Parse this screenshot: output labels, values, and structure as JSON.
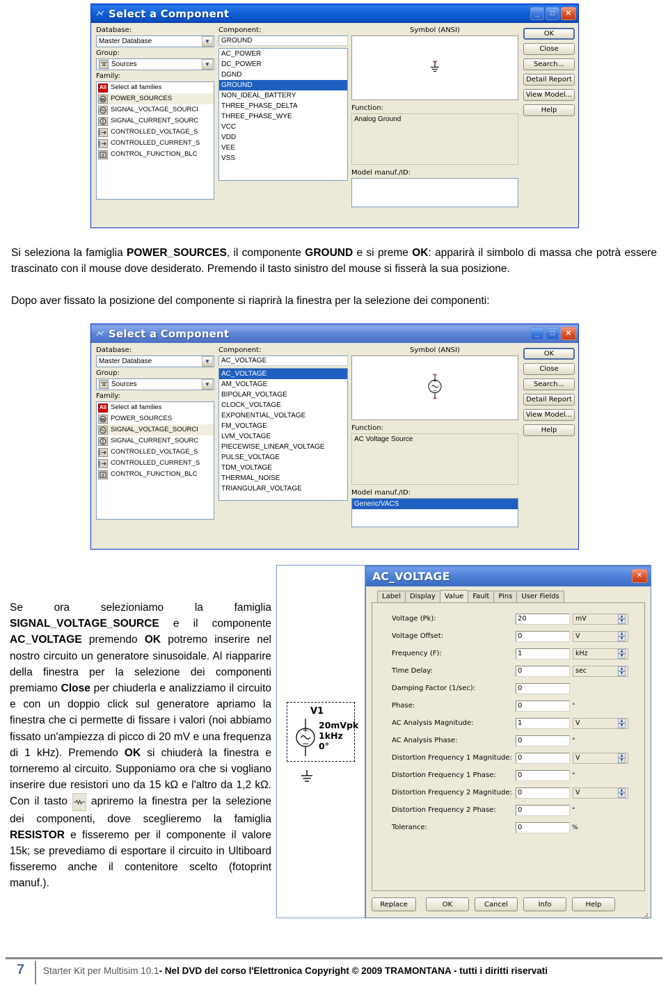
{
  "document": {
    "page_number": "7",
    "footer": {
      "part1": "Starter Kit per Multisim 10.1",
      "part2": "- Nel DVD del corso l'Elettronica",
      "part3": " Copyright © 2009 TRAMONTANA - tutti i diritti riservati"
    }
  },
  "dialog1": {
    "title": "Select a Component",
    "title_icon": "component-icon",
    "minimize": "_",
    "maximize": "□",
    "close": "✕",
    "labels": {
      "database": "Database:",
      "group": "Group:",
      "family": "Family:",
      "component": "Component:",
      "symbol": "Symbol (ANSI)",
      "function": "Function:",
      "model": "Model manuf./ID:"
    },
    "database_value": "Master Database",
    "group_value": "Sources",
    "component_value": "GROUND",
    "function_value": "Analog Ground",
    "model_value": "",
    "families": [
      {
        "icon": "all-icon",
        "label": "Select all families"
      },
      {
        "icon": "power-sources-icon",
        "label": "POWER_SOURCES"
      },
      {
        "icon": "signal-voltage-icon",
        "label": "SIGNAL_VOLTAGE_SOURCI"
      },
      {
        "icon": "signal-current-icon",
        "label": "SIGNAL_CURRENT_SOURC"
      },
      {
        "icon": "controlled-voltage-icon",
        "label": "CONTROLLED_VOLTAGE_S"
      },
      {
        "icon": "controlled-current-icon",
        "label": "CONTROLLED_CURRENT_S"
      },
      {
        "icon": "control-function-icon",
        "label": "CONTROL_FUNCTION_BLC"
      }
    ],
    "family_selected_index": 1,
    "components": [
      "AC_POWER",
      "DC_POWER",
      "DGND",
      "GROUND",
      "NON_IDEAL_BATTERY",
      "THREE_PHASE_DELTA",
      "THREE_PHASE_WYE",
      "VCC",
      "VDD",
      "VEE",
      "VSS"
    ],
    "component_selected_index": 3,
    "buttons": [
      "OK",
      "Close",
      "Search...",
      "Detail Report",
      "View Model...",
      "Help"
    ],
    "symbol": "ground-symbol"
  },
  "paragraph1": {
    "line1_a": "Si seleziona la famiglia ",
    "line1_b": "POWER_SOURCES",
    "line1_c": ", il componente ",
    "line1_d": "GROUND",
    "line1_e": " e si preme ",
    "line1_f": "OK",
    "line1_g": ": apparirà il simbolo di massa che potrà essere trascinato con il mouse dove desiderato. Premendo il tasto sinistro del mouse si fisserà la sua posizione.",
    "line2": "Dopo aver fissato la posizione del componente si riaprirà la finestra per la selezione dei componenti:"
  },
  "dialog2": {
    "title": "Select a Component",
    "title_icon": "component-icon",
    "minimize": "_",
    "maximize": "□",
    "close": "✕",
    "labels": {
      "database": "Database:",
      "group": "Group:",
      "family": "Family:",
      "component": "Component:",
      "symbol": "Symbol (ANSI)",
      "function": "Function:",
      "model": "Model manuf./ID:"
    },
    "database_value": "Master Database",
    "group_value": "Sources",
    "component_value": "AC_VOLTAGE",
    "function_value": "AC Voltage Source",
    "model_value": "Generic/VACS",
    "families": [
      {
        "icon": "all-icon",
        "label": "Select all families"
      },
      {
        "icon": "power-sources-icon",
        "label": "POWER_SOURCES"
      },
      {
        "icon": "signal-voltage-icon",
        "label": "SIGNAL_VOLTAGE_SOURCI"
      },
      {
        "icon": "signal-current-icon",
        "label": "SIGNAL_CURRENT_SOURC"
      },
      {
        "icon": "controlled-voltage-icon",
        "label": "CONTROLLED_VOLTAGE_S"
      },
      {
        "icon": "controlled-current-icon",
        "label": "CONTROLLED_CURRENT_S"
      },
      {
        "icon": "control-function-icon",
        "label": "CONTROL_FUNCTION_BLC"
      }
    ],
    "family_selected_index": 2,
    "components": [
      "AC_VOLTAGE",
      "AM_VOLTAGE",
      "BIPOLAR_VOLTAGE",
      "CLOCK_VOLTAGE",
      "EXPONENTIAL_VOLTAGE",
      "FM_VOLTAGE",
      "LVM_VOLTAGE",
      "PIECEWISE_LINEAR_VOLTAGE",
      "PULSE_VOLTAGE",
      "TDM_VOLTAGE",
      "THERMAL_NOISE",
      "TRIANGULAR_VOLTAGE"
    ],
    "component_selected_index": 0,
    "buttons": [
      "OK",
      "Close",
      "Search...",
      "Detail Report",
      "View Model...",
      "Help"
    ],
    "symbol": "ac-source-symbol"
  },
  "column_text": {
    "s1": "Se ora selezioniamo la famiglia ",
    "b1": "SIGNAL_VOLTAGE_SOURCE",
    "s2": " e il componente ",
    "b2": "AC_VOLTAGE",
    "s3": " premendo ",
    "b3": "OK",
    "s4": " potremo inserire nel nostro circuito un generatore sinusoidale. Al riapparire della finestra per la selezione dei componenti premiamo ",
    "b4": "Close",
    "s5": " per chiuderla e analizziamo il circuito e con un doppio click sul generatore apriamo la finestra che ci permette di fissare i valori (noi abbiamo fissato un'ampiezza di picco di 20 mV e una frequenza di 1 kHz). Premendo ",
    "b5": "OK",
    "s6": " si chiuderà la finestra e torneremo al circuito. Supponiamo ora che si vogliano inserire due resistori uno da 15 kΩ e l'altro da 1,2 kΩ. Con il tasto ",
    "icon1": "resistor-icon",
    "s7": " apriremo la finestra per la selezione dei componenti, dove sceglieremo la famiglia ",
    "b6": "RESISTOR",
    "s8": " e fisseremo per il componente il valore 15k; se prevediamo di esportare il circuito in Ultiboard fisseremo anche il contenitore scelto (fotoprint manuf.)."
  },
  "circuit": {
    "ref": "V1",
    "amplitude": "20mVpk",
    "frequency": "1kHz",
    "phase": "0°",
    "ground": "ground-symbol"
  },
  "prop_dialog": {
    "title": "AC_VOLTAGE",
    "close": "✕",
    "tabs": [
      "Label",
      "Display",
      "Value",
      "Fault",
      "Pins",
      "User Fields"
    ],
    "active_tab_index": 2,
    "rows": [
      {
        "label": "Voltage (Pk):",
        "value": "20",
        "unit": "mV",
        "spinner": true
      },
      {
        "label": "Voltage Offset:",
        "value": "0",
        "unit": "V",
        "spinner": true
      },
      {
        "label": "Frequency (F):",
        "value": "1",
        "unit": "kHz",
        "spinner": true
      },
      {
        "label": "Time Delay:",
        "value": "0",
        "unit": "sec",
        "spinner": true
      },
      {
        "label": "Damping Factor (1/sec):",
        "value": "0",
        "unit": "",
        "spinner": false
      },
      {
        "label": "Phase:",
        "value": "0",
        "unit": "°",
        "spinner": false
      },
      {
        "label": "AC Analysis Magnitude:",
        "value": "1",
        "unit": "V",
        "spinner": true
      },
      {
        "label": "AC Analysis Phase:",
        "value": "0",
        "unit": "°",
        "spinner": false
      },
      {
        "label": "Distortion Frequency 1 Magnitude:",
        "value": "0",
        "unit": "V",
        "spinner": true
      },
      {
        "label": "Distortion Frequency 1 Phase:",
        "value": "0",
        "unit": "°",
        "spinner": false
      },
      {
        "label": "Distortion Frequency 2 Magnitude:",
        "value": "0",
        "unit": "V",
        "spinner": true
      },
      {
        "label": "Distortion Frequency 2 Phase:",
        "value": "0",
        "unit": "°",
        "spinner": false
      },
      {
        "label": "Tolerance:",
        "value": "0",
        "unit": "%",
        "spinner": false
      }
    ],
    "buttons": [
      "Replace",
      "OK",
      "Cancel",
      "Info",
      "Help"
    ]
  },
  "colors": {
    "title_blue": "#0a5fd4",
    "dialog_face": "#ece9d8",
    "selection_blue": "#1f5fbf",
    "close_red": "#c23a14"
  }
}
